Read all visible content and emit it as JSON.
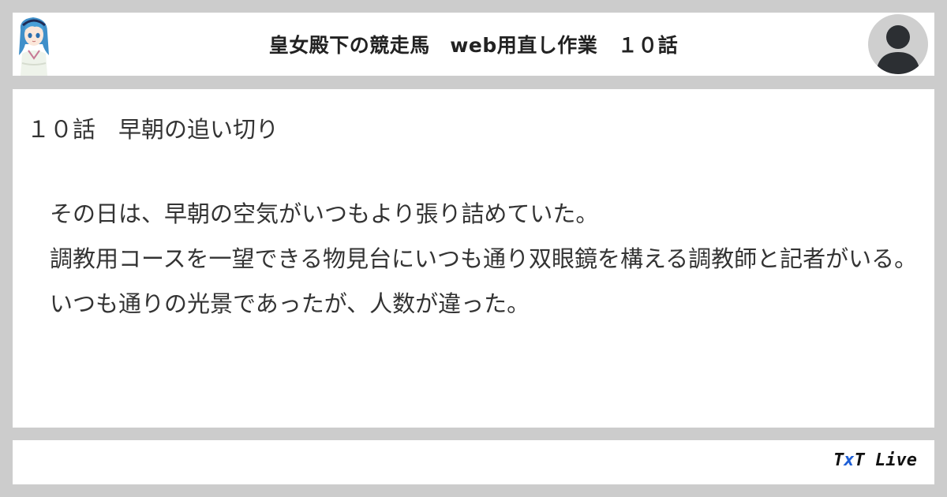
{
  "header": {
    "title": "皇女殿下の競走馬　web用直し作業　１０話",
    "character_avatar_icon": "anime-character-avatar",
    "user_avatar_icon": "user-avatar-icon"
  },
  "content": {
    "chapter_title": "１０話　早朝の追い切り",
    "paragraphs": [
      "　その日は、早朝の空気がいつもより張り詰めていた。",
      "　調教用コースを一望できる物見台にいつも通り双眼鏡を構える調教師と記者がいる。",
      "　いつも通りの光景であったが、人数が違った。"
    ]
  },
  "footer": {
    "brand_t1": "T",
    "brand_x": "x",
    "brand_rest": "T Live",
    "accent_color": "#1e5fd6"
  },
  "colors": {
    "background": "#cccccc",
    "panel": "#ffffff",
    "text": "#333333"
  }
}
